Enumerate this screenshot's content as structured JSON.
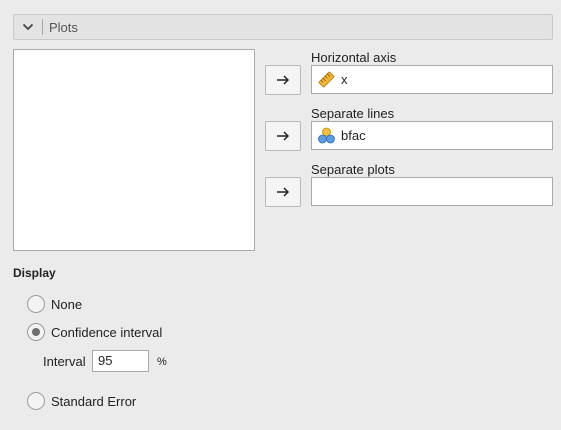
{
  "panel": {
    "title": "Plots",
    "collapse_icon": "chevron-down-icon"
  },
  "variables_list": {
    "items": []
  },
  "targets": [
    {
      "label": "Horizontal axis",
      "value": "x",
      "icon": "ruler-icon",
      "button_icon": "arrow-right-icon"
    },
    {
      "label": "Separate lines",
      "value": "bfac",
      "icon": "nominal-circles-icon",
      "button_icon": "arrow-right-icon"
    },
    {
      "label": "Separate plots",
      "value": "",
      "button_icon": "arrow-right-icon"
    }
  ],
  "display": {
    "title": "Display",
    "options": [
      {
        "label": "None",
        "selected": false
      },
      {
        "label": "Confidence interval",
        "selected": true
      },
      {
        "label": "Standard Error",
        "selected": false
      }
    ],
    "interval": {
      "label": "Interval",
      "value": "95",
      "unit": "%"
    }
  },
  "colors": {
    "background": "#ebebeb",
    "ruler": "#f0b63c",
    "circle_gold": "#f0c040",
    "circle_blue": "#5b9be0"
  }
}
